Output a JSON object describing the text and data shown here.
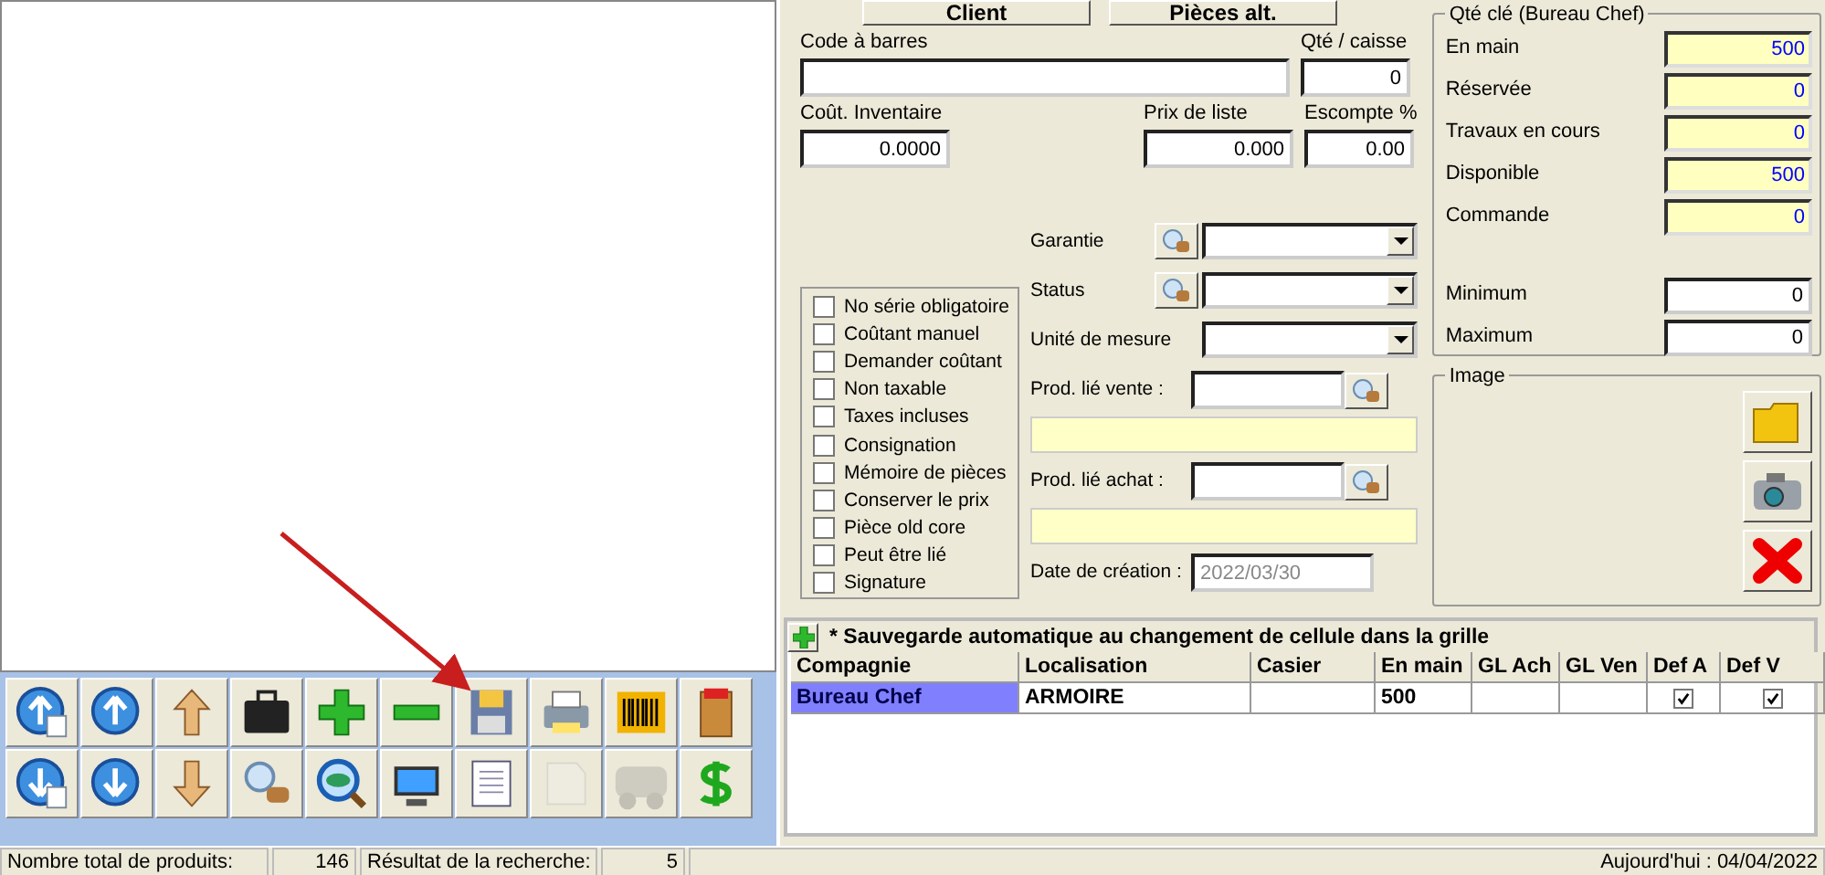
{
  "top_buttons": [
    {
      "label": "Client"
    },
    {
      "label": "Pièces alt."
    }
  ],
  "fields": {
    "barcode": {
      "label": "Code à barres"
    },
    "qty_per_case": {
      "label": "Qté / caisse",
      "value": "0"
    },
    "inventory_cost": {
      "label": "Coût. Inventaire",
      "value": "0.0000"
    },
    "list_price": {
      "label": "Prix de liste",
      "value": "0.000"
    },
    "discount": {
      "label": "Escompte %",
      "value": "0.00"
    }
  },
  "dropdowns": [
    {
      "label": "Garantie",
      "lookup": true
    },
    {
      "label": "Status",
      "lookup": true
    },
    {
      "label": "Unité de mesure",
      "lookup": false
    }
  ],
  "options": [
    {
      "label": "No série obligatoire",
      "checked": false
    },
    {
      "label": "Coûtant manuel",
      "checked": false
    },
    {
      "label": "Demander coûtant",
      "checked": false
    },
    {
      "label": "Non taxable",
      "checked": false
    },
    {
      "label": "Taxes incluses",
      "checked": false
    },
    {
      "label": "Consignation",
      "checked": false
    },
    {
      "label": "Mémoire de pièces",
      "checked": false
    },
    {
      "label": "Conserver le prix",
      "checked": false
    },
    {
      "label": "Pièce old core",
      "checked": false
    },
    {
      "label": "Peut être lié",
      "checked": false
    },
    {
      "label": "Signature",
      "checked": false
    }
  ],
  "linked": [
    {
      "label": "Prod. lié vente :"
    },
    {
      "label": "Prod. lié achat :"
    }
  ],
  "creation_date": {
    "label": "Date de création :",
    "value": "2022/03/30"
  },
  "stock": {
    "title": "Qté clé (Bureau Chef)",
    "rows": [
      {
        "label": "En main",
        "value": "500"
      },
      {
        "label": "Réservée",
        "value": "0"
      },
      {
        "label": "Travaux en cours",
        "value": "0"
      },
      {
        "label": "Disponible",
        "value": "500"
      },
      {
        "label": "Commande",
        "value": "0"
      }
    ],
    "limits": [
      {
        "label": "Minimum",
        "value": "0"
      },
      {
        "label": "Maximum",
        "value": "0"
      }
    ]
  },
  "image": {
    "title": "Image"
  },
  "toolbar": [
    {
      "disabled": false
    },
    {
      "disabled": false
    },
    {
      "disabled": false
    },
    {
      "disabled": false
    },
    {
      "disabled": false
    },
    {
      "disabled": false
    },
    {
      "disabled": false
    },
    {
      "disabled": false
    },
    {
      "disabled": false
    },
    {
      "disabled": false
    },
    {
      "disabled": false
    },
    {
      "disabled": false
    },
    {
      "disabled": false
    },
    {
      "disabled": false
    },
    {
      "disabled": false
    },
    {
      "disabled": false
    },
    {
      "disabled": false
    },
    {
      "disabled": true
    },
    {
      "disabled": true
    },
    {
      "disabled": false
    }
  ],
  "grid": {
    "note": "* Sauvegarde automatique au changement de cellule dans la grille",
    "columns": [
      "Compagnie",
      "Localisation",
      "Casier",
      "En main",
      "GL Ach",
      "GL Ven",
      "Def A",
      "Def V"
    ],
    "rows": [
      {
        "cells": [
          "Bureau Chef",
          "ARMOIRE",
          "",
          "500",
          "",
          ""
        ],
        "def_a": true,
        "def_v": true,
        "selected": true
      }
    ]
  },
  "status_bar": {
    "total_label": "Nombre total de produits:",
    "total": "146",
    "result_label": "Résultat de la recherche:",
    "result": "5",
    "today": "Aujourd'hui : 04/04/2022"
  }
}
